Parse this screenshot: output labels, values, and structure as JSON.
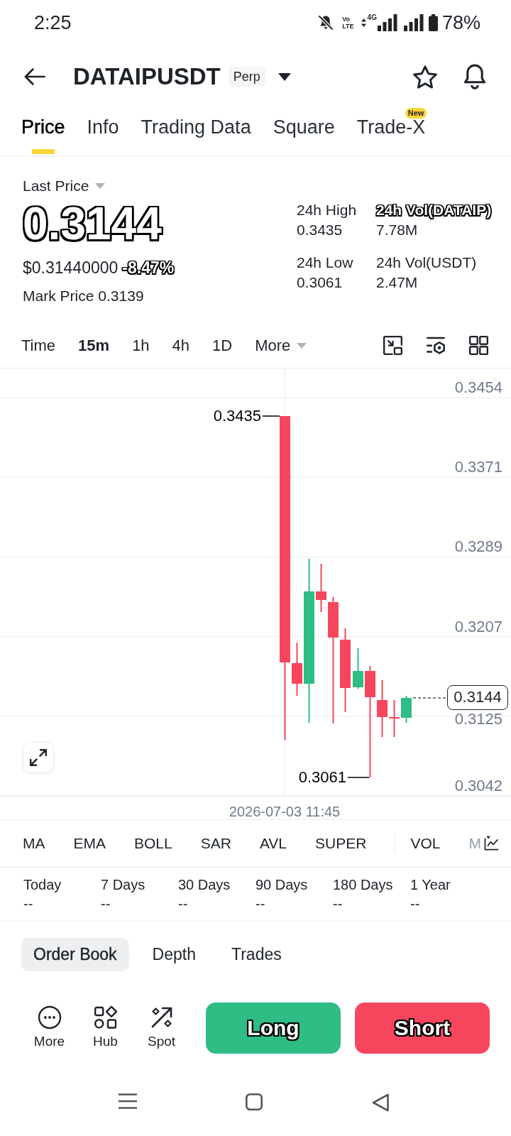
{
  "status_bar": {
    "time": "2:25",
    "volte": [
      "Vo",
      "LTE"
    ],
    "network_type": "4G",
    "battery": "78%"
  },
  "header": {
    "symbol": "DATAIPUSDT",
    "contract_tag": "Perp"
  },
  "tabs": [
    {
      "label": "Price",
      "selected": true
    },
    {
      "label": "Info",
      "selected": false
    },
    {
      "label": "Trading Data",
      "selected": false
    },
    {
      "label": "Square",
      "selected": false
    },
    {
      "label": "Trade-X",
      "selected": false,
      "badge": "New"
    }
  ],
  "price": {
    "label": "Last Price",
    "last": "0.3144",
    "usd_value": "$0.31440000",
    "change": "-8.47%",
    "mark_label": "Mark Price",
    "mark_value": "0.3139"
  },
  "stats": [
    {
      "label": "24h High",
      "value": "0.3435",
      "highlighted": false
    },
    {
      "label": "24h Vol(DATAIP)",
      "value": "7.78M",
      "highlighted": true
    },
    {
      "label": "24h Low",
      "value": "0.3061",
      "highlighted": false
    },
    {
      "label": "24h Vol(USDT)",
      "value": "2.47M",
      "highlighted": false
    }
  ],
  "intervals": [
    {
      "label": "Time",
      "kind": "option",
      "selected": false
    },
    {
      "label": "15m",
      "kind": "option",
      "selected": true
    },
    {
      "label": "1h",
      "kind": "option",
      "selected": false
    },
    {
      "label": "4h",
      "kind": "option",
      "selected": false
    },
    {
      "label": "1D",
      "kind": "option",
      "selected": false
    },
    {
      "label": "More",
      "kind": "dropdown",
      "selected": false
    }
  ],
  "chart": {
    "price_labels": [
      "0.3454",
      "0.3371",
      "0.3289",
      "0.3207",
      "0.3125",
      "0.3042"
    ],
    "high_label": "0.3435",
    "low_label": "0.3061",
    "current_price": "0.3144",
    "time_label": "2026-07-03 11:45",
    "candles": [
      {
        "kind": "falling"
      },
      {
        "kind": "falling"
      },
      {
        "kind": "rising"
      },
      {
        "kind": "falling"
      },
      {
        "kind": "falling"
      },
      {
        "kind": "falling"
      },
      {
        "kind": "rising"
      },
      {
        "kind": "falling"
      },
      {
        "kind": "falling"
      },
      {
        "kind": "falling"
      },
      {
        "kind": "rising"
      }
    ]
  },
  "indicators": {
    "main": [
      "MA",
      "EMA",
      "BOLL",
      "SAR",
      "AVL",
      "SUPER"
    ],
    "sub": [
      "VOL"
    ],
    "partial": "M"
  },
  "periods": [
    {
      "label": "Today",
      "value": "--"
    },
    {
      "label": "7 Days",
      "value": "--"
    },
    {
      "label": "30 Days",
      "value": "--"
    },
    {
      "label": "90 Days",
      "value": "--"
    },
    {
      "label": "180 Days",
      "value": "--"
    },
    {
      "label": "1 Year",
      "value": "--"
    }
  ],
  "book_tabs": [
    {
      "label": "Order Book",
      "selected": true
    },
    {
      "label": "Depth",
      "selected": false
    },
    {
      "label": "Trades",
      "selected": false
    }
  ],
  "toolbar": [
    {
      "label": "More",
      "kind": "more"
    },
    {
      "label": "Hub",
      "kind": "hub"
    },
    {
      "label": "Spot",
      "kind": "spot"
    }
  ],
  "trade_buttons": [
    {
      "label": "Long",
      "kind": "buy"
    },
    {
      "label": "Short",
      "kind": "sell"
    }
  ]
}
